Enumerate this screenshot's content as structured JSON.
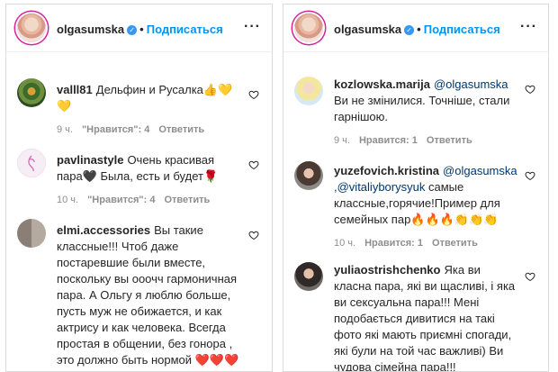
{
  "left": {
    "header": {
      "username": "olgasumska",
      "follow": "Подписаться"
    },
    "comments": [
      {
        "user": "valll81",
        "text": "Дельфин и Русалка👍💛💛",
        "time": "9 ч.",
        "likes": "\"Нравится\": 4",
        "reply": "Ответить"
      },
      {
        "user": "pavlinastyle",
        "text": "Очень красивая пара🖤 Была, есть и будет🌹",
        "time": "10 ч.",
        "likes": "\"Нравится\": 4",
        "reply": "Ответить"
      },
      {
        "user": "elmi.accessories",
        "text": "Вы такие классные!!! Чтоб даже постаревшие были вместе, поскольку вы ооочч гармоничная пара. А Ольгу я люблю больше, пусть муж не обижается, и как актрису и как человека. Всегда простая в общении, без гонора , это должно быть нормой ❤️❤️❤️"
      }
    ]
  },
  "right": {
    "header": {
      "username": "olgasumska",
      "follow": "Подписаться"
    },
    "comments": [
      {
        "user": "kozlowska.marija",
        "mention": "@olgasumska",
        "text": "Ви не змінилися. Точніше, стали гарнішою.",
        "time": "9 ч.",
        "likes": "Нравится: 1",
        "reply": "Ответить"
      },
      {
        "user": "yuzefovich.kristina",
        "mention": "@olgasumska",
        "mention2": ",@vitaliyborysyuk",
        "text": "самые классные,горячие!Пример для семейных пар🔥🔥🔥👏👏👏",
        "time": "10 ч.",
        "likes": "Нравится: 1",
        "reply": "Ответить"
      },
      {
        "user": "yuliaostrishchenko",
        "text": "Яка ви класна пара, які ви щасливі, і яка ви сексуальна пара!!! Мені подобається дивитися на такі фото які мають приємні спогади, які були на той час важливі) Ви чудова сімейна пара!!!"
      }
    ]
  },
  "colors": {
    "link": "#0095f6",
    "mention": "#00376b",
    "muted": "#8e8e8e",
    "verified": "#3897f0"
  }
}
